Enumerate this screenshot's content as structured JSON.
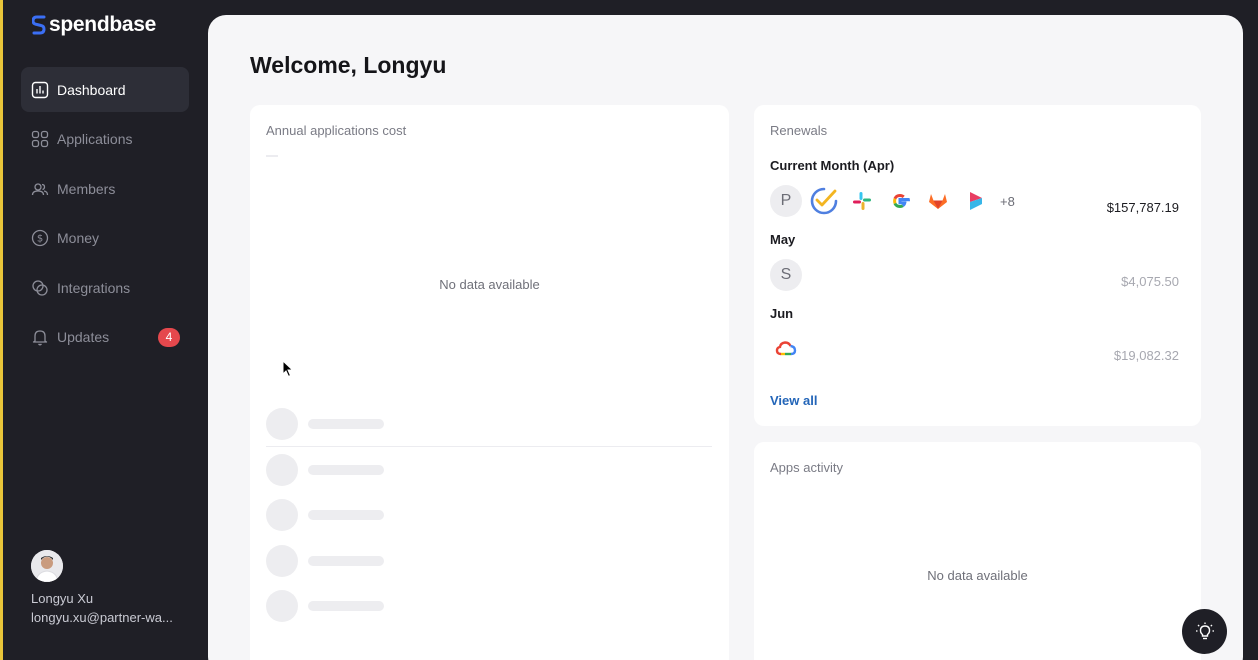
{
  "brand": {
    "name": "spendbase"
  },
  "sidebar": {
    "items": [
      {
        "label": "Dashboard",
        "icon": "chart-icon",
        "active": true
      },
      {
        "label": "Applications",
        "icon": "grid-icon"
      },
      {
        "label": "Members",
        "icon": "users-icon"
      },
      {
        "label": "Money",
        "icon": "dollar-icon"
      },
      {
        "label": "Integrations",
        "icon": "integrations-icon"
      },
      {
        "label": "Updates",
        "icon": "bell-icon",
        "badge": "4"
      }
    ]
  },
  "user": {
    "name": "Longyu Xu",
    "email": "longyu.xu@partner-wa..."
  },
  "main": {
    "welcome": "Welcome, Longyu"
  },
  "cost_card": {
    "title": "Annual applications cost",
    "empty": "No data available"
  },
  "renewals": {
    "title": "Renewals",
    "periods": [
      {
        "label": "Current Month (Apr)",
        "amount": "$157,787.19",
        "more": "+8"
      },
      {
        "label": "May",
        "amount": "$4,075.50",
        "letter": "S"
      },
      {
        "label": "Jun",
        "amount": "$19,082.32"
      }
    ],
    "current_letter": "P",
    "view_all": "View all"
  },
  "activity": {
    "title": "Apps activity",
    "empty": "No data available"
  },
  "colors": {
    "accent": "#2365b8",
    "badge": "#e5484d",
    "sidebar": "#1f1f26",
    "background": "#f6f6f8"
  }
}
